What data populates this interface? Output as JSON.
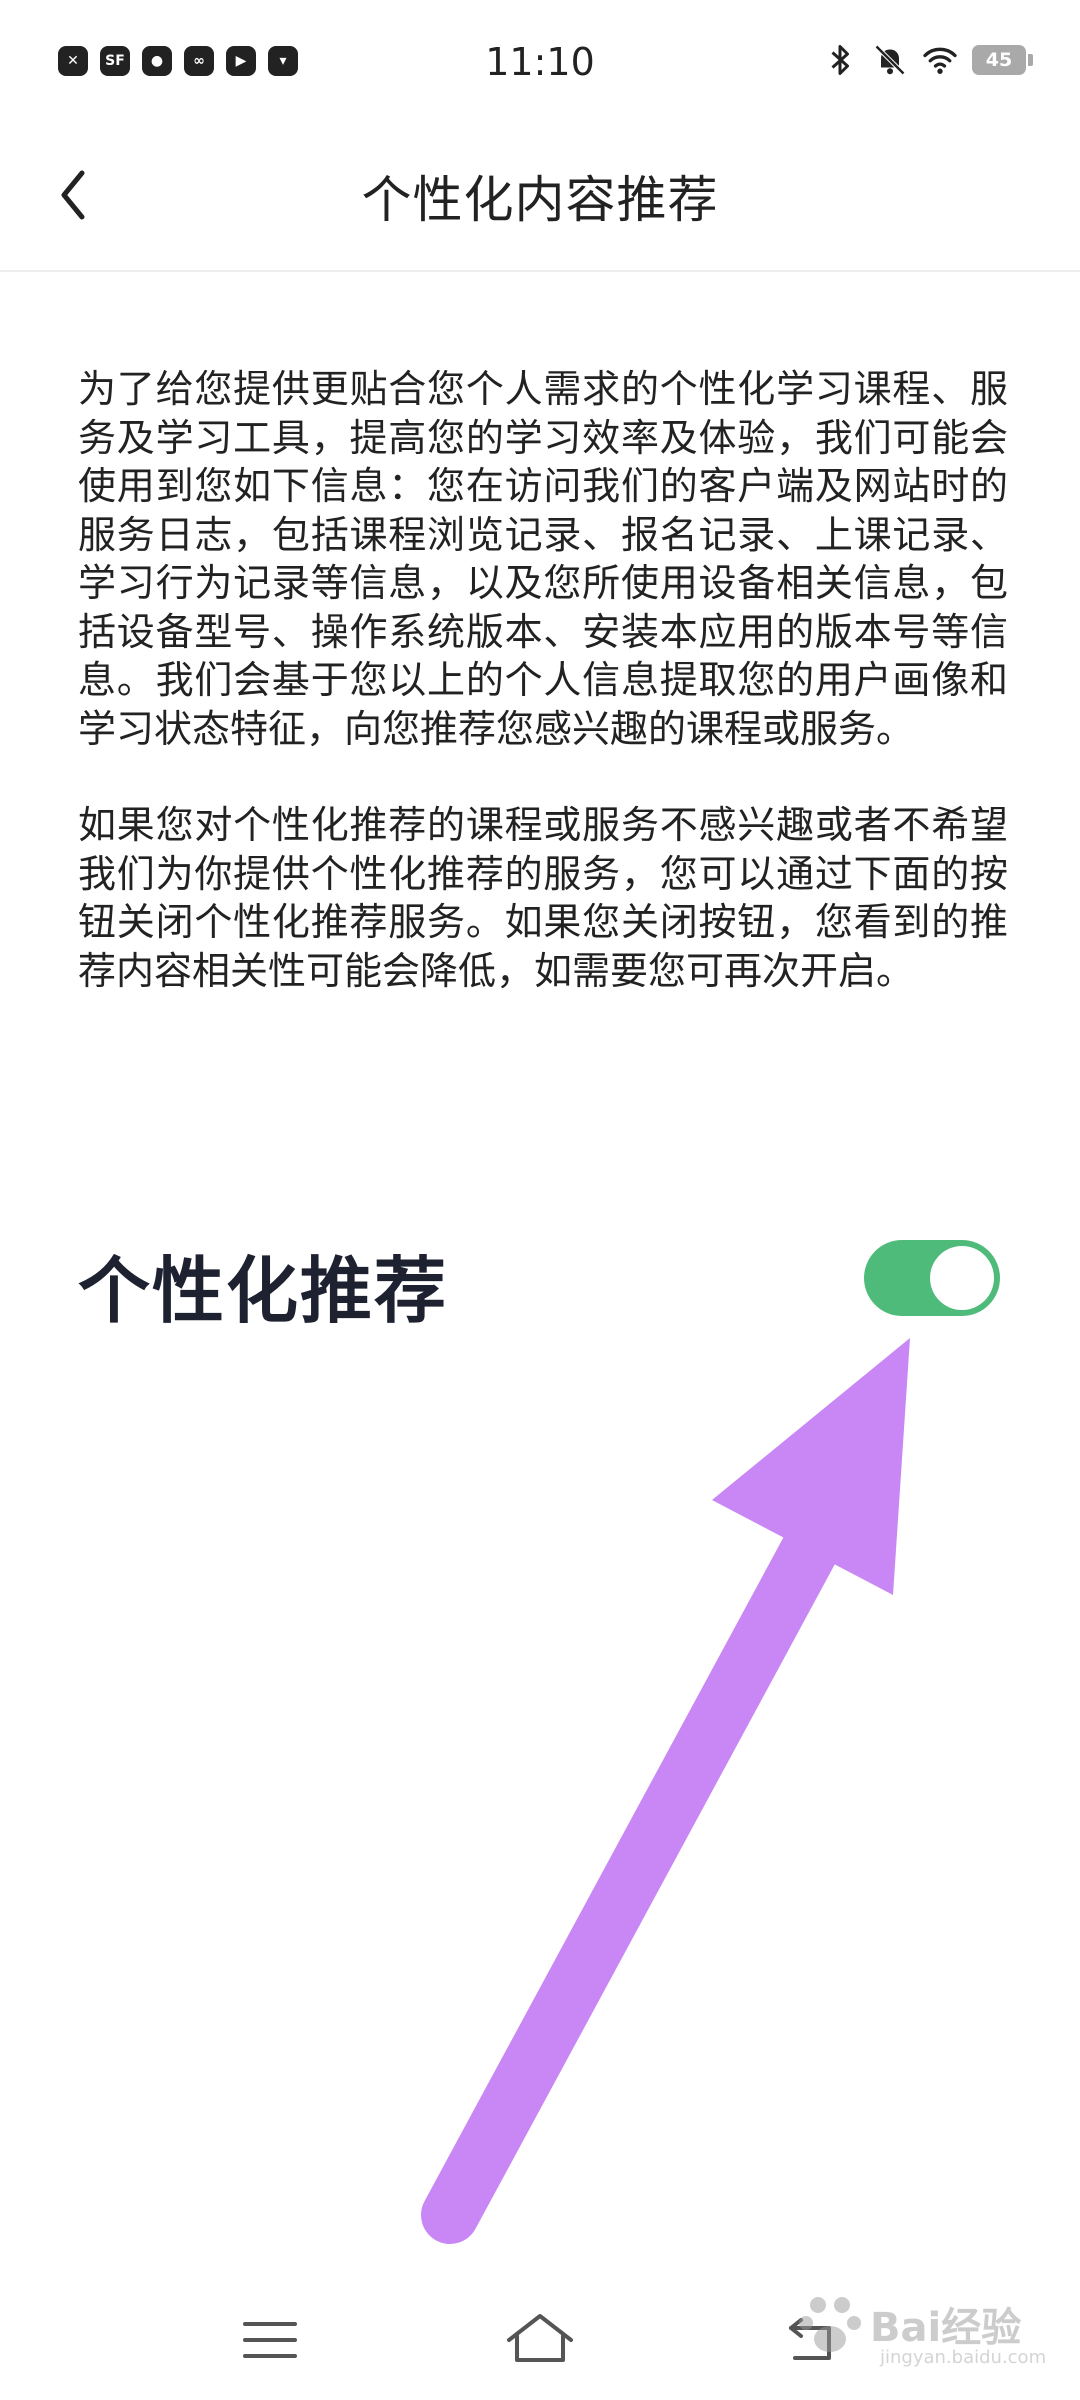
{
  "status_bar": {
    "time": "11:10",
    "battery_level": "45",
    "app_icons": [
      "x-app-icon",
      "sf-app-icon",
      "chat-bubble-icon",
      "link-app-icon",
      "play-circle-icon",
      "bag-app-icon"
    ],
    "app_icon_glyphs": [
      "✕",
      "SF",
      "●",
      "∞",
      "▶",
      "▾"
    ],
    "right_icons": [
      "bluetooth-icon",
      "bell-muted-icon",
      "wifi-icon",
      "battery-icon"
    ]
  },
  "header": {
    "title": "个性化内容推荐",
    "back_icon": "chevron-left-icon"
  },
  "content": {
    "paragraph_1": "为了给您提供更贴合您个人需求的个性化学习课程、服务及学习工具，提高您的学习效率及体验，我们可能会使用到您如下信息：您在访问我们的客户端及网站时的服务日志，包括课程浏览记录、报名记录、上课记录、学习行为记录等信息，以及您所使用设备相关信息，包括设备型号、操作系统版本、安装本应用的版本号等信息。我们会基于您以上的个人信息提取您的用户画像和学习状态特征，向您推荐您感兴趣的课程或服务。",
    "paragraph_2": "如果您对个性化推荐的课程或服务不感兴趣或者不希望我们为你提供个性化推荐的服务，您可以通过下面的按钮关闭个性化推荐服务。如果您关闭按钮，您看到的推荐内容相关性可能会降低，如需要您可再次开启。"
  },
  "setting": {
    "label": "个性化推荐",
    "enabled": true
  },
  "nav_bar": {
    "icons": [
      "menu-icon",
      "home-icon",
      "back-icon"
    ]
  },
  "watermark": {
    "text": "Bai经验",
    "sub": "jingyan.baidu.com"
  },
  "colors": {
    "toggle_on": "#4fbb7a",
    "annotation_arrow": "#c987f5",
    "text_primary": "#222222",
    "label_dark": "#1d2130"
  }
}
